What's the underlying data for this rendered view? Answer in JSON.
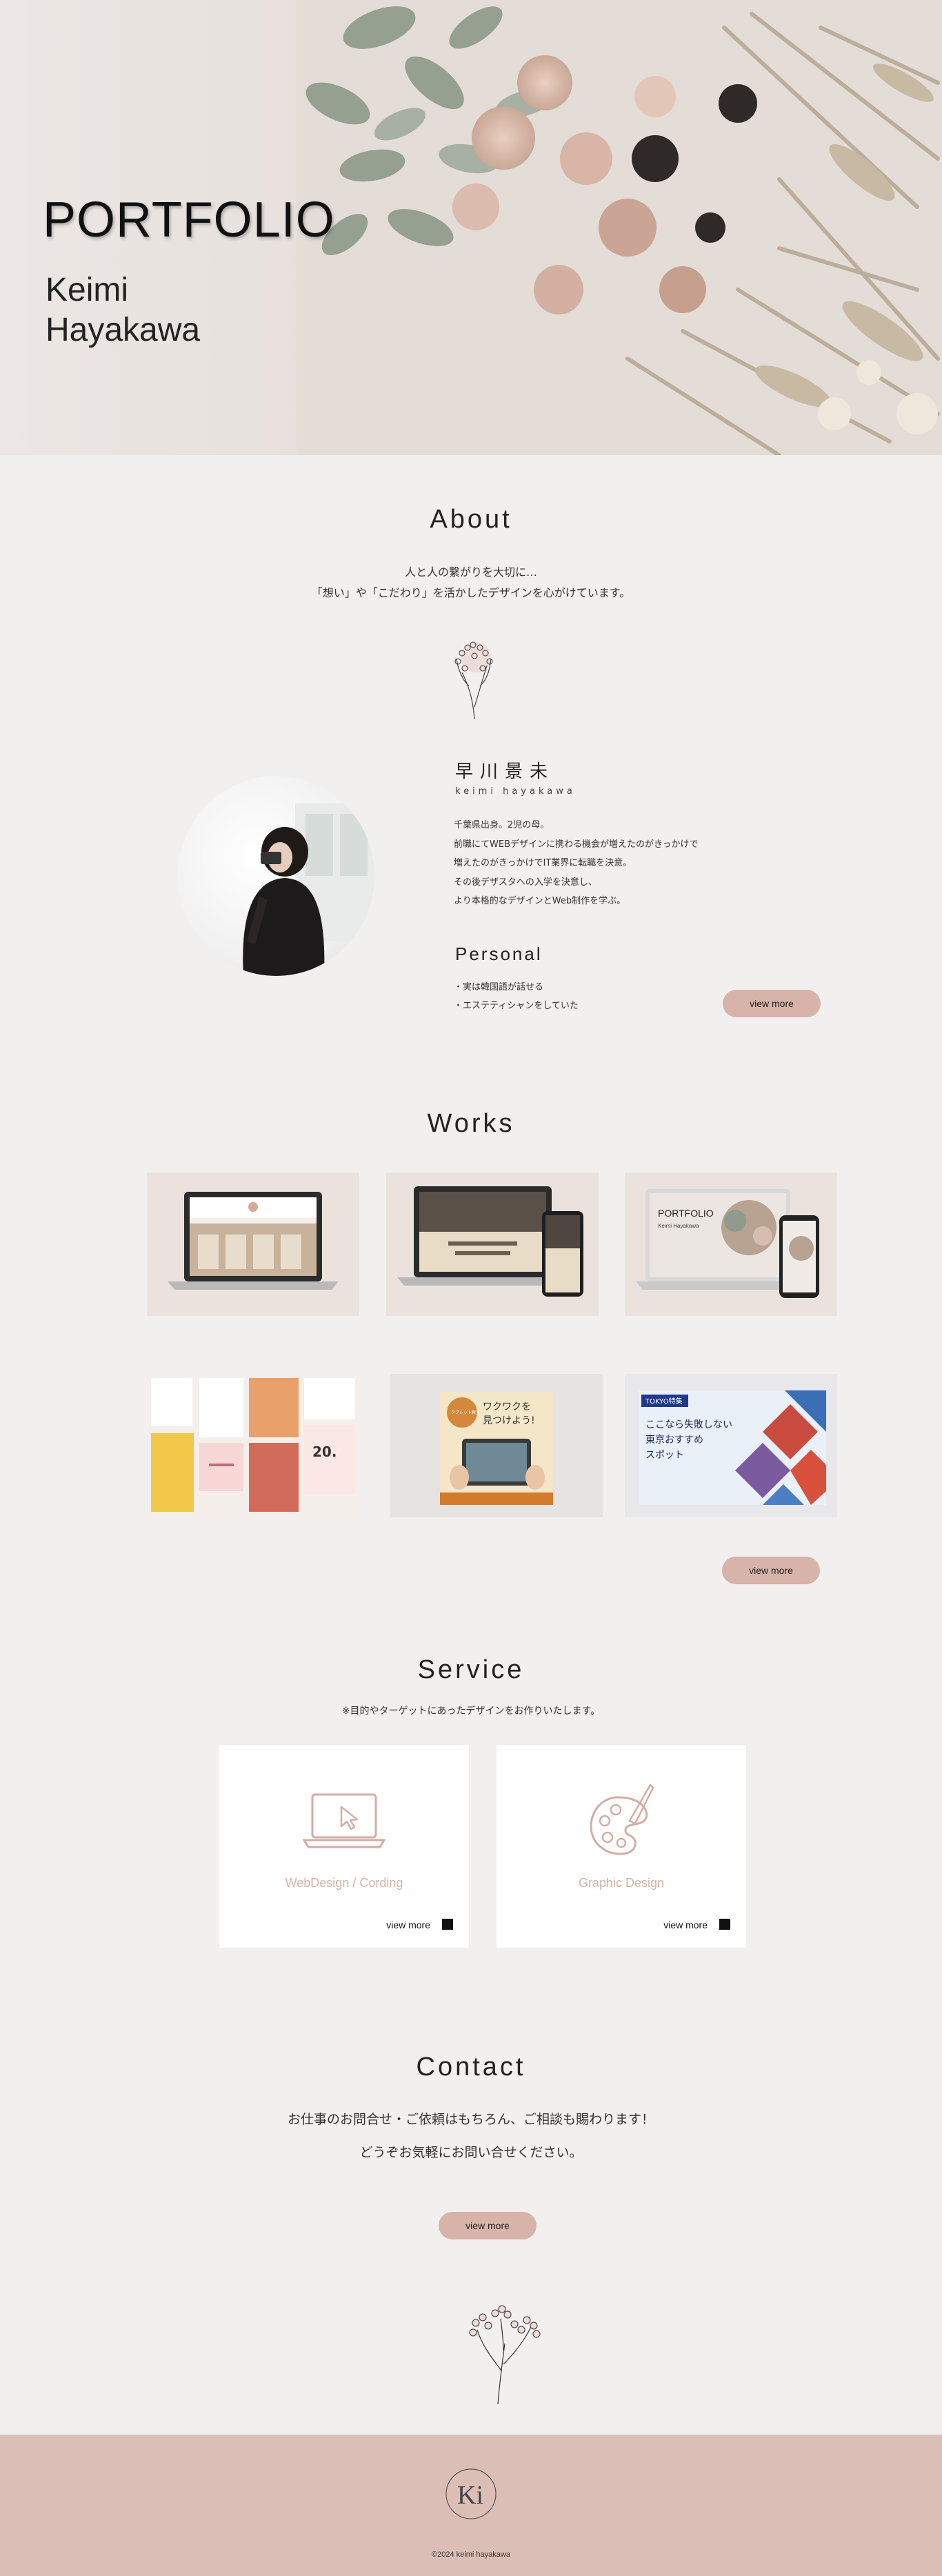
{
  "hero": {
    "title": "PORTFOLIO",
    "name": "Keimi Hayakawa"
  },
  "about": {
    "heading": "About",
    "intro_line1": "人と人の繋がりを大切に…",
    "intro_line2": "「想い」や「こだわり」を活かしたデザインを心がけています。",
    "jp_name": "早川景未",
    "roman_name": "keimi hayakawa",
    "bio": [
      "千葉県出身。2児の母。",
      "前職にてWEBデザインに携わる機会が増えたのがきっかけで",
      "増えたのがきっかけでIT業界に転職を決意。",
      "その後デザスタへの入学を決意し、",
      "より本格的なデザインとWeb制作を学ぶ。"
    ],
    "personal_heading": "Personal",
    "personal": [
      "・実は韓国語が話せる",
      "・エステティシャンをしていた"
    ],
    "more_label": "view more"
  },
  "works": {
    "heading": "Works",
    "more_label": "view more",
    "items": [
      {
        "kind": "laptop-salon"
      },
      {
        "kind": "laptop-cafe"
      },
      {
        "kind": "portfolio-mock",
        "mini_title": "PORTFOLIO",
        "mini_name": "Keimi Hayakawa"
      },
      {
        "kind": "banner-collage"
      },
      {
        "kind": "tablet-banner",
        "badge": "タブレット教室",
        "headline_1": "ワクワクを",
        "headline_2": "見つけよう!"
      },
      {
        "kind": "tokyo-banner",
        "tag": "TOKYO特集",
        "line1": "ここなら失敗しない",
        "line2": "東京おすすめ",
        "line3": "スポット"
      }
    ]
  },
  "service": {
    "heading": "Service",
    "subtitle": "※目的やターゲットにあったデザインをお作りいたします。",
    "cards": [
      {
        "label": "WebDesign / Cording",
        "more": "view more"
      },
      {
        "label": "Graphic Design",
        "more": "view more"
      }
    ]
  },
  "contact": {
    "heading": "Contact",
    "line1": "お仕事のお問合せ・ご依頼はもちろん、ご相談も賜わります！",
    "line2": "どうぞお気軽にお問い合せください。",
    "more_label": "view more"
  },
  "footer": {
    "logo_text": "Ki",
    "copyright": "©2024 keimi hayakawa"
  },
  "colors": {
    "accent": "#d8b3a9",
    "footer": "#dbbfb7",
    "icon": "#d2aea3"
  }
}
